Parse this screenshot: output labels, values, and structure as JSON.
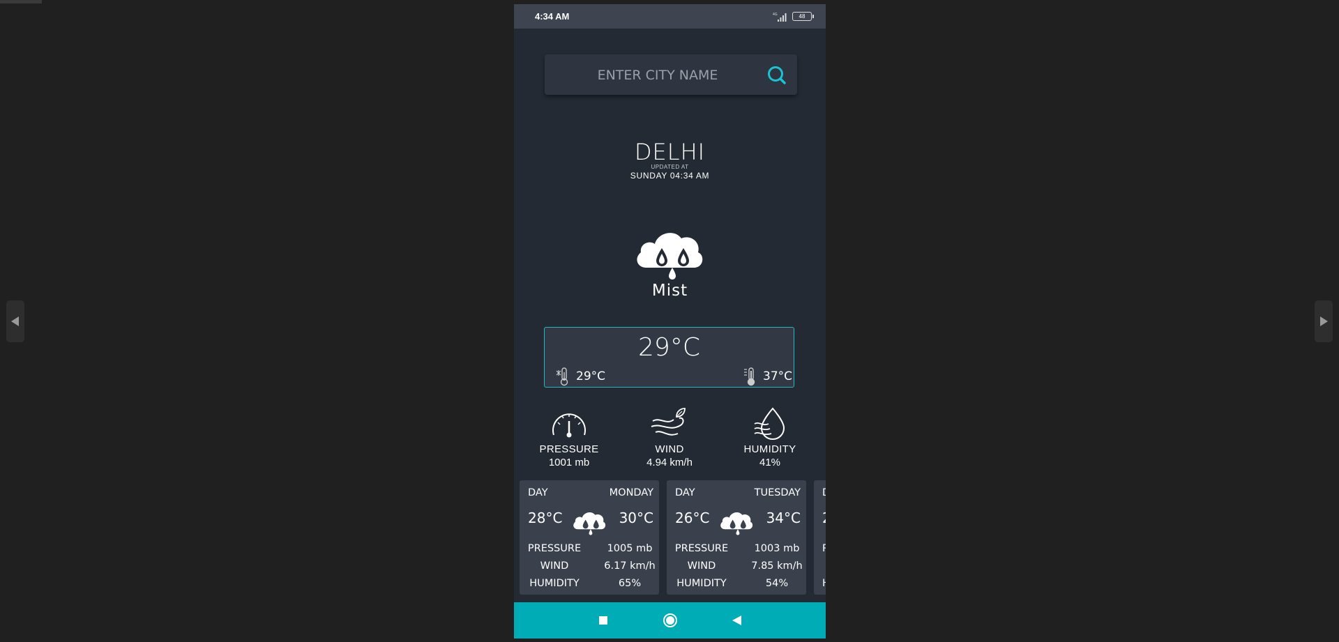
{
  "status_bar": {
    "time": "4:34 AM",
    "network": "4G",
    "battery": "48"
  },
  "search": {
    "placeholder": "ENTER CITY NAME"
  },
  "location": {
    "city": "DELHI",
    "updated_label": "UPDATED AT",
    "updated_time": "SUNDAY 04:34 AM"
  },
  "current": {
    "condition": "Mist",
    "condition_icon": "rain-cloud-icon",
    "temperature": "29°C",
    "min_temp": "29°C",
    "max_temp": "37°C"
  },
  "stats": [
    {
      "label": "PRESSURE",
      "value": "1001 mb",
      "icon": "pressure-gauge-icon"
    },
    {
      "label": "WIND",
      "value": "4.94 km/h",
      "icon": "wind-icon"
    },
    {
      "label": "HUMIDITY",
      "value": "41%",
      "icon": "humidity-drop-icon"
    }
  ],
  "forecast": [
    {
      "day_label": "DAY",
      "day": "MONDAY",
      "min": "28°C",
      "max": "30°C",
      "pressure_label": "PRESSURE",
      "pressure": "1005 mb",
      "wind_label": "WIND",
      "wind": "6.17 km/h",
      "humidity_label": "HUMIDITY",
      "humidity": "65%"
    },
    {
      "day_label": "DAY",
      "day": "TUESDAY",
      "min": "26°C",
      "max": "34°C",
      "pressure_label": "PRESSURE",
      "pressure": "1003 mb",
      "wind_label": "WIND",
      "wind": "7.85 km/h",
      "humidity_label": "HUMIDITY",
      "humidity": "54%"
    },
    {
      "day_label": "D",
      "day": "",
      "min": "2",
      "max": "",
      "pressure_label": "P",
      "pressure": "",
      "wind_label": "",
      "wind": "",
      "humidity_label": "H",
      "humidity": ""
    }
  ],
  "colors": {
    "accent": "#00acb6",
    "background": "#232a34",
    "card": "#3a414d",
    "outer": "#202020"
  }
}
